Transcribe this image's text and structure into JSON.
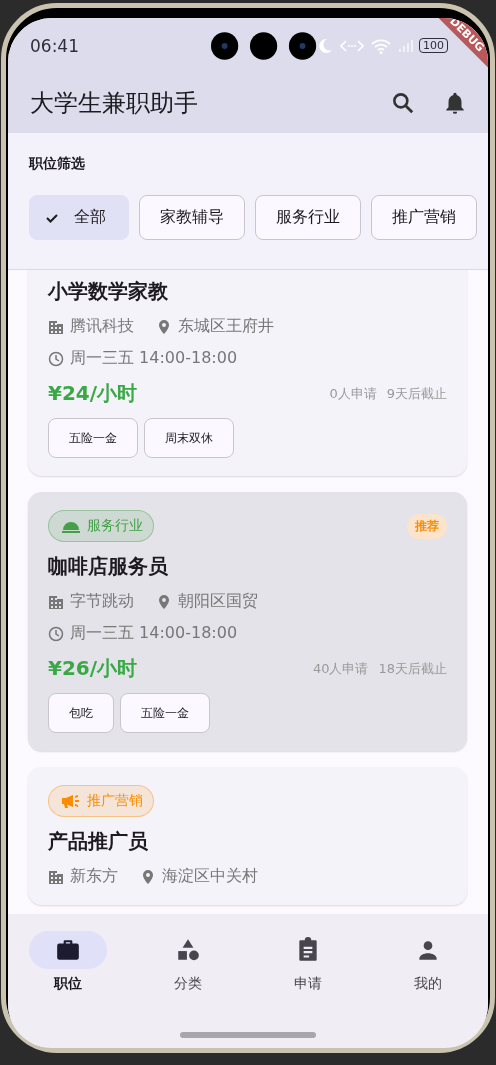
{
  "status_bar": {
    "time": "06:41",
    "battery": "100"
  },
  "debug_banner": "DEBUG",
  "app_bar": {
    "title": "大学生兼职助手"
  },
  "filter": {
    "label": "职位筛选",
    "chips": [
      {
        "label": "全部",
        "selected": true
      },
      {
        "label": "家教辅导",
        "selected": false
      },
      {
        "label": "服务行业",
        "selected": false
      },
      {
        "label": "推广营销",
        "selected": false
      }
    ]
  },
  "jobs": [
    {
      "title": "小学数学家教",
      "company": "腾讯科技",
      "location": "东城区王府井",
      "schedule": "周一三五 14:00-18:00",
      "pay": "¥24/小时",
      "applicants": "0人申请",
      "deadline": "9天后截止",
      "perks": [
        "五险一金",
        "周末双休"
      ],
      "selected": false
    },
    {
      "category": {
        "kind": "service",
        "label": "服务行业",
        "color": "#43a047"
      },
      "recommended": "推荐",
      "title": "咖啡店服务员",
      "company": "字节跳动",
      "location": "朝阳区国贸",
      "schedule": "周一三五 14:00-18:00",
      "pay": "¥26/小时",
      "applicants": "40人申请",
      "deadline": "18天后截止",
      "perks": [
        "包吃",
        "五险一金"
      ],
      "selected": true
    },
    {
      "category": {
        "kind": "marketing",
        "label": "推广营销",
        "color": "#fb8c00"
      },
      "title": "产品推广员",
      "company": "新东方",
      "location": "海淀区中关村",
      "selected": false
    }
  ],
  "nav": [
    {
      "kind": "jobs",
      "label": "职位",
      "selected": true
    },
    {
      "kind": "categories",
      "label": "分类",
      "selected": false
    },
    {
      "kind": "applications",
      "label": "申请",
      "selected": false
    },
    {
      "kind": "profile",
      "label": "我的",
      "selected": false
    }
  ]
}
